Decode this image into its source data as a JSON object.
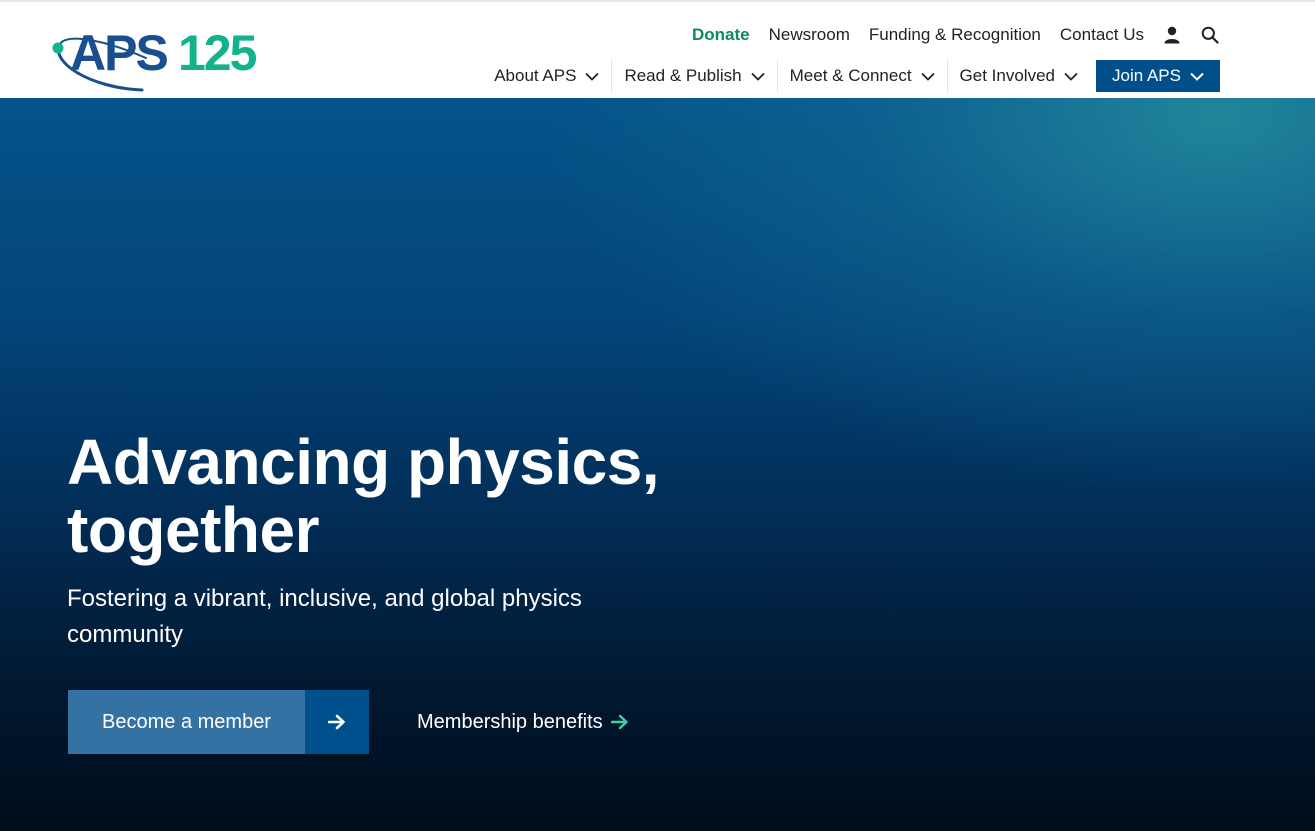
{
  "brand": {
    "logo_text_blue": "APS",
    "logo_text_green": "125",
    "blue": "#1a4f8f",
    "green": "#12b38a"
  },
  "utility_nav": {
    "donate": "Donate",
    "newsroom": "Newsroom",
    "funding": "Funding & Recognition",
    "contact": "Contact Us",
    "account_icon": "user-icon",
    "search_icon": "search-icon"
  },
  "main_nav": {
    "items": [
      {
        "label": "About APS"
      },
      {
        "label": "Read & Publish"
      },
      {
        "label": "Meet & Connect"
      },
      {
        "label": "Get Involved"
      }
    ],
    "join_label": "Join APS",
    "join_color": "#004f8b"
  },
  "hero": {
    "title_line1": "Advancing physics,",
    "title_line2": "together",
    "subtitle_line1": "Fostering a vibrant, inclusive, and global physics",
    "subtitle_line2": "community",
    "cta_label": "Become a member",
    "cta_color": "#3572a4",
    "benefits_label": "Membership benefits",
    "benefits_arrow_color": "#3fd1a6"
  }
}
